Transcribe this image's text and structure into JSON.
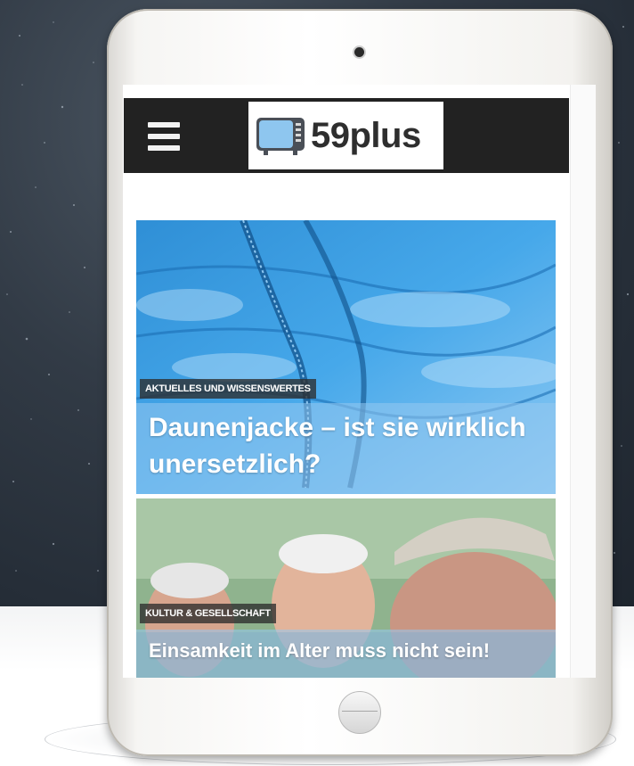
{
  "site": {
    "logo_text": "59plus",
    "icons": {
      "menu": "hamburger-menu-icon",
      "logo": "tv-icon"
    }
  },
  "articles": [
    {
      "category": "Aktuelles und Wissenswertes",
      "title": "Daunenjacke – ist sie wirklich unersetzlich?"
    },
    {
      "category": "Kultur & Gesellschaft",
      "title": "Einsamkeit im Alter muss nicht sein!"
    }
  ],
  "colors": {
    "header_bg": "#222222",
    "headline_overlay": "#96c8f0",
    "category_bg": "#2d2d2d"
  }
}
